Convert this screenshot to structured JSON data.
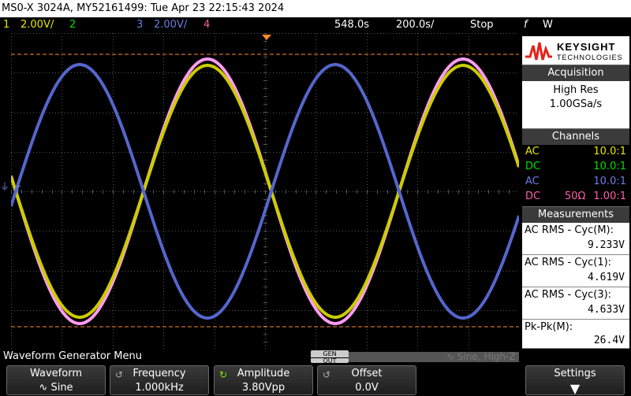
{
  "title": "MS0-X 3024A, MY52161499: Tue Apr 23 22:15:43 2024",
  "status": {
    "ch1_num": "1",
    "ch1_scale": "2.00V/",
    "ch2_num": "2",
    "ch3_num": "3",
    "ch3_scale": "2.00V/",
    "ch4_num": "4",
    "delay": "548.0s",
    "timebase": "200.0s/",
    "run_state": "Stop",
    "trigger_edge": "f",
    "trigger_mode": "W"
  },
  "colors": {
    "ch1": "#e6e600",
    "ch2": "#00e000",
    "ch3": "#6b7ce4",
    "ch4": "#ff5fa8",
    "math": "#ff9cf0",
    "grid": "#555555",
    "cursor": "#ff8a2a"
  },
  "trigger_marker": "T",
  "side": {
    "brand1": "KEYSIGHT",
    "brand2": "TECHNOLOGIES",
    "acquisition_head": "Acquisition",
    "acq_mode": "High Res",
    "acq_rate": "1.00GSa/s",
    "channels_head": "Channels",
    "channels": [
      {
        "coupling": "AC",
        "imp": "",
        "probe": "10.0:1",
        "color": "#e6e600"
      },
      {
        "coupling": "DC",
        "imp": "",
        "probe": "10.0:1",
        "color": "#00e000"
      },
      {
        "coupling": "AC",
        "imp": "",
        "probe": "10.0:1",
        "color": "#6b7ce4"
      },
      {
        "coupling": "DC",
        "imp": "50Ω",
        "probe": "1.00:1",
        "color": "#ff5fa8"
      }
    ],
    "measurements_head": "Measurements",
    "measurements": [
      {
        "label": "AC RMS - Cyc(M):",
        "value": "9.233V"
      },
      {
        "label": "AC RMS - Cyc(1):",
        "value": "4.619V"
      },
      {
        "label": "AC RMS - Cyc(3):",
        "value": "4.633V"
      },
      {
        "label": "Pk-Pk(M):",
        "value": "26.4V"
      }
    ]
  },
  "menu": {
    "title": "Waveform Generator Menu",
    "gen_out_1": "GEN",
    "gen_out_2": "OUT",
    "gen_status": "Sine, High-Z"
  },
  "softkeys": {
    "waveform_label": "Waveform",
    "waveform_value": "Sine",
    "frequency_label": "Frequency",
    "frequency_value": "1.000kHz",
    "amplitude_label": "Amplitude",
    "amplitude_value": "3.80Vpp",
    "offset_label": "Offset",
    "offset_value": "0.0V",
    "settings_label": "Settings"
  }
}
